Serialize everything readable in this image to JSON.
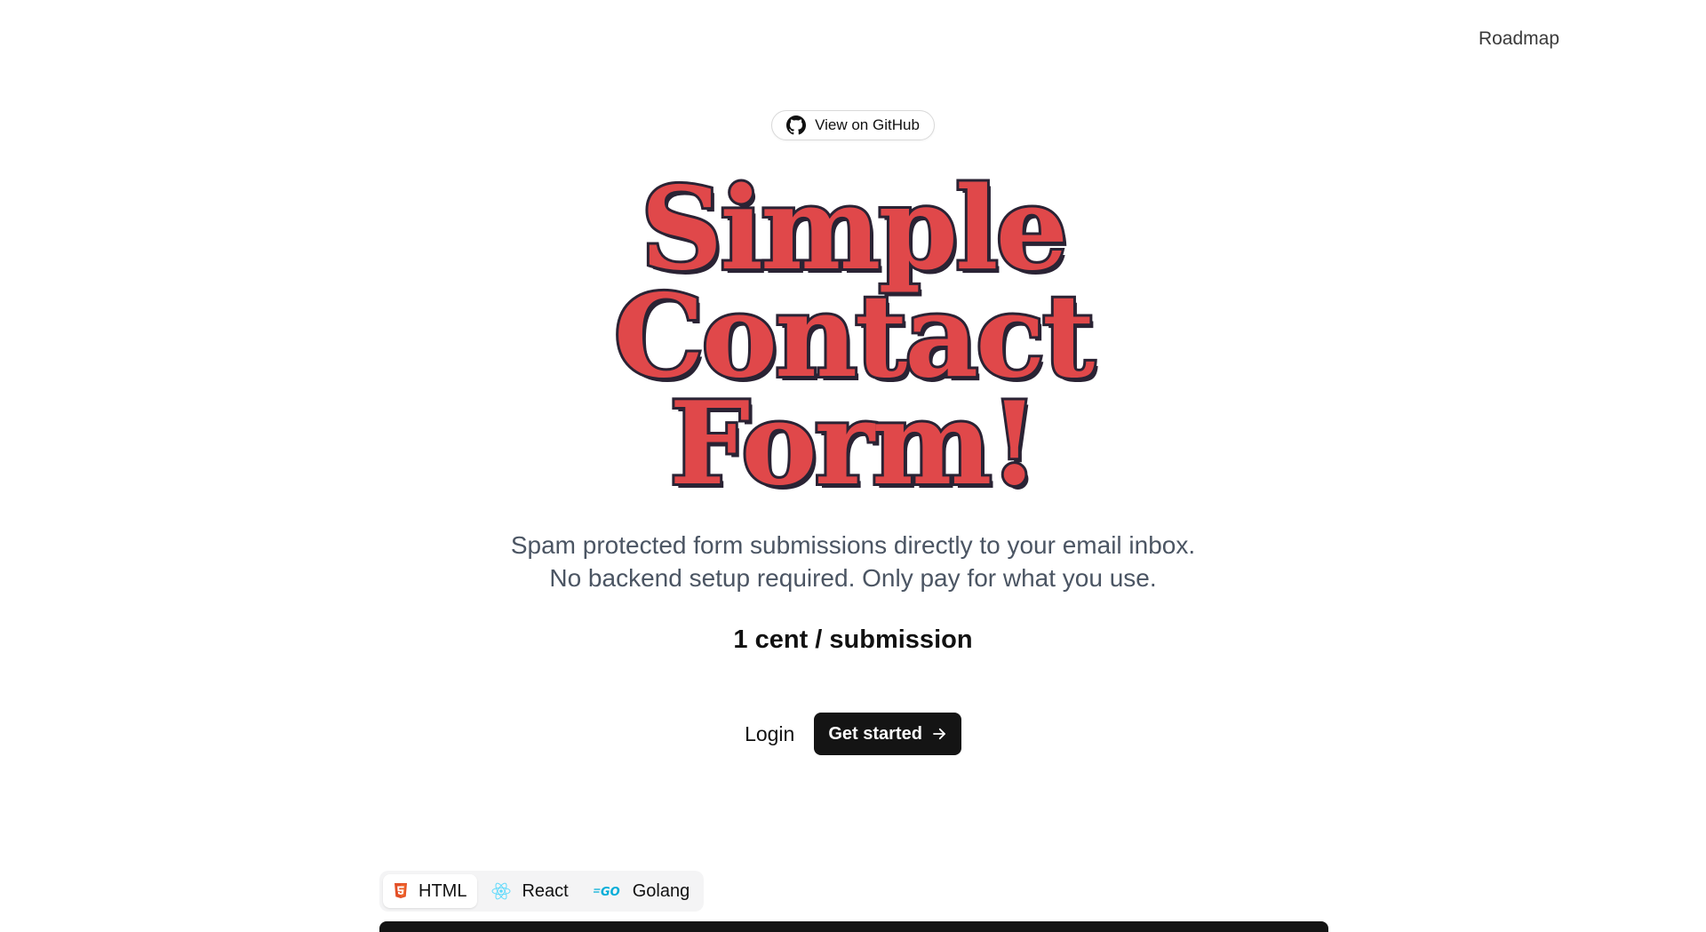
{
  "nav": {
    "roadmap": "Roadmap"
  },
  "github_badge": {
    "label": "View on GitHub",
    "icon": "github-icon"
  },
  "hero": {
    "title_lines": [
      "Simple",
      "Contact",
      "Form!"
    ],
    "subtitle_lines": [
      "Spam protected form submissions directly to your email inbox.",
      "No backend setup required. Only pay for what you use."
    ],
    "price": "1 cent / submission"
  },
  "cta": {
    "login": "Login",
    "get_started": "Get started",
    "get_started_icon": "arrow-right-icon"
  },
  "tabs": [
    {
      "label": "HTML",
      "icon": "html5-icon",
      "active": true
    },
    {
      "label": "React",
      "icon": "react-icon",
      "active": false
    },
    {
      "label": "Golang",
      "icon": "go-icon",
      "active": false
    }
  ],
  "colors": {
    "title_fill": "#e0484a",
    "title_outline": "#2a2334",
    "primary_button": "#141414",
    "subtitle_text": "#4b5563",
    "html5_orange": "#e34f26",
    "react_cyan": "#61dafb",
    "go_blue": "#00add8"
  }
}
